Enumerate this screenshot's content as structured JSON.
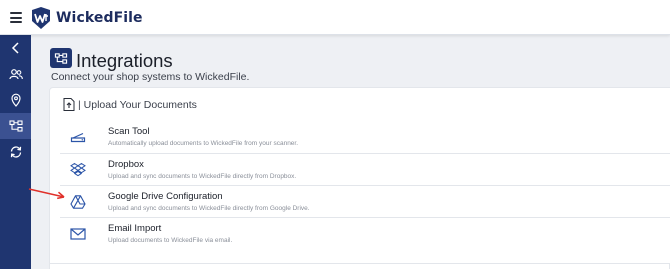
{
  "app": {
    "brand": "WickedFile"
  },
  "page": {
    "title": "Integrations",
    "subtitle": "Connect your shop systems to WickedFile."
  },
  "upload_card": {
    "title": "| Upload Your Documents",
    "items": [
      {
        "icon": "scanner-icon",
        "title": "Scan Tool",
        "description": "Automatically upload documents to WickedFile from your scanner."
      },
      {
        "icon": "dropbox-icon",
        "title": "Dropbox",
        "description": "Upload and sync documents to WickedFile directly from Dropbox."
      },
      {
        "icon": "google-drive-icon",
        "title": "Google Drive Configuration",
        "description": "Upload and sync documents to WickedFile directly from Google Drive."
      },
      {
        "icon": "envelope-icon",
        "title": "Email Import",
        "description": "Upload documents to WickedFile via email."
      }
    ]
  },
  "sidebar": {
    "items": [
      {
        "icon": "chevron-left-icon",
        "active": false
      },
      {
        "icon": "users-icon",
        "active": false
      },
      {
        "icon": "location-pin-icon",
        "active": false
      },
      {
        "icon": "integrations-icon",
        "active": true
      },
      {
        "icon": "sync-icon",
        "active": false
      }
    ]
  },
  "colors": {
    "brand_navy": "#1f3570",
    "sidebar_active": "#3b5191",
    "annotation_arrow": "#e0302a",
    "icon_blue": "#2c55a8"
  }
}
